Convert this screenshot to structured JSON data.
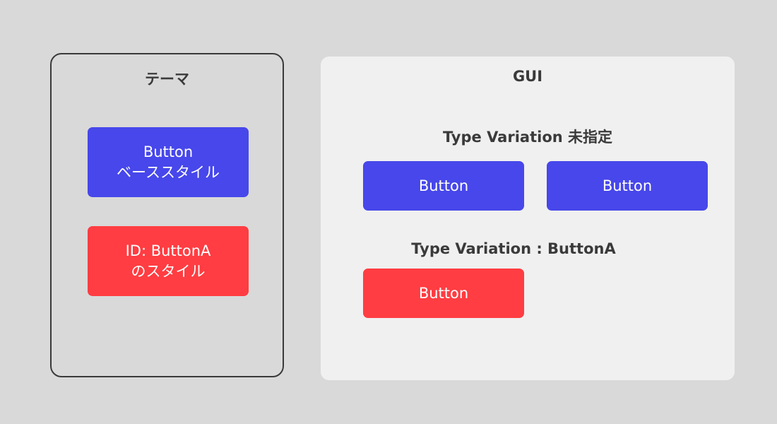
{
  "colors": {
    "base": "#4747eb",
    "variation": "#ff3d42"
  },
  "theme": {
    "title": "テーマ",
    "base_style": {
      "line1": "Button",
      "line2": "ベーススタイル"
    },
    "variation_style": {
      "line1": "ID: ButtonA",
      "line2": "のスタイル"
    }
  },
  "gui": {
    "title": "GUI",
    "default_section": {
      "title": "Type Variation 未指定",
      "buttons": [
        "Button",
        "Button"
      ]
    },
    "variation_section": {
      "title": "Type Variation : ButtonA",
      "buttons": [
        "Button"
      ]
    }
  }
}
